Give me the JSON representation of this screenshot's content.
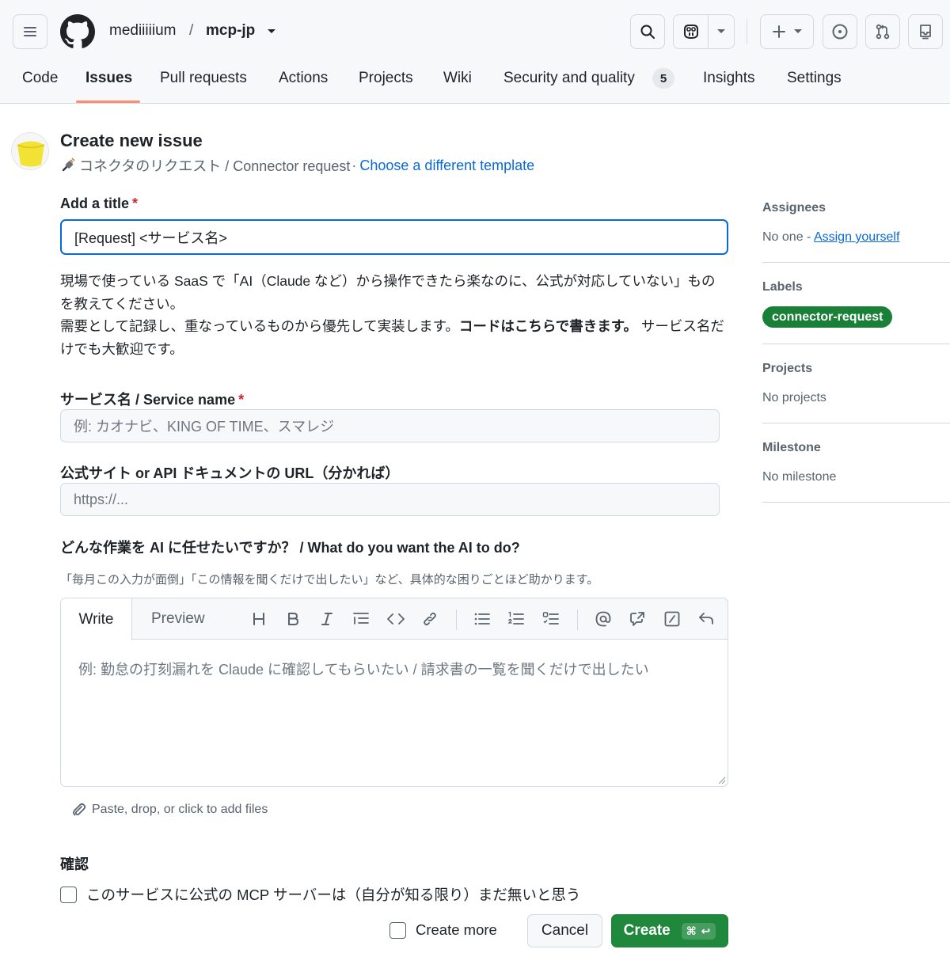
{
  "header": {
    "owner": "mediiiiium",
    "separator": "/",
    "repo": "mcp-jp"
  },
  "nav": {
    "items": [
      {
        "label": "Code"
      },
      {
        "label": "Issues"
      },
      {
        "label": "Pull requests"
      },
      {
        "label": "Actions"
      },
      {
        "label": "Projects"
      },
      {
        "label": "Wiki"
      },
      {
        "label": "Security and quality"
      },
      {
        "label": "Insights"
      },
      {
        "label": "Settings"
      }
    ],
    "selected": "Issues",
    "security_count": "5"
  },
  "page": {
    "title": "Create new issue",
    "template_name": "コネクタのリクエスト / Connector request",
    "template_dot": "·",
    "choose_template": "Choose a different template"
  },
  "form": {
    "title_label": "Add a title",
    "required_mark": "*",
    "title_value": "[Request] <サービス名>",
    "description_line1": "現場で使っている SaaS で「AI（Claude など）から操作できたら楽なのに、公式が対応していない」ものを教えてください。",
    "description_line2a": "需要として記録し、重なっているものから優先して実装します。",
    "description_line2b": "コードはこちらで書きます。",
    "description_line2c": " サービス名だけでも大歓迎です。",
    "service_label": "サービス名 / Service name",
    "service_placeholder": "例: カオナビ、KING OF TIME、スマレジ",
    "url_label": "公式サイト or API ドキュメントの URL（分かれば）",
    "url_placeholder": "https://...",
    "task_label": "どんな作業を AI に任せたいですか？ / What do you want the AI to do?",
    "task_hint": "「毎月この入力が面倒」「この情報を聞くだけで出したい」など、具体的な困りごとほど助かります。",
    "editor": {
      "write_tab": "Write",
      "preview_tab": "Preview",
      "placeholder": "例: 勤怠の打刻漏れを Claude に確認してもらいたい / 請求書の一覧を聞くだけで出したい"
    },
    "attach_text": "Paste, drop, or click to add files",
    "confirm_heading": "確認",
    "confirm_checkbox_label": "このサービスに公式の MCP サーバーは（自分が知る限り）まだ無いと思う",
    "confirm_checked": false,
    "create_more_label": "Create more",
    "create_more_checked": false,
    "cancel_label": "Cancel",
    "create_label": "Create",
    "create_shortcut": "⌘ ↩"
  },
  "sidebar": {
    "assignees_heading": "Assignees",
    "assignees_none": "No one - ",
    "assign_yourself": "Assign yourself",
    "labels_heading": "Labels",
    "label_name": "connector-request",
    "label_color": "#1a7f37",
    "projects_heading": "Projects",
    "projects_none": "No projects",
    "milestone_heading": "Milestone",
    "milestone_none": "No milestone"
  },
  "icons": {
    "menu": "hamburger-icon",
    "logo": "github-mark-icon",
    "search": "search-icon",
    "copilot": "copilot-icon",
    "plus": "plus-icon",
    "issues": "issue-opened-icon",
    "pull_requests": "git-pull-request-icon",
    "inbox": "inbox-icon",
    "attach": "paperclip-icon"
  },
  "colors": {
    "accent": "#0969da",
    "nav_underline": "#fd8c73",
    "primary_button": "#1f883d",
    "required": "#d1242f"
  }
}
